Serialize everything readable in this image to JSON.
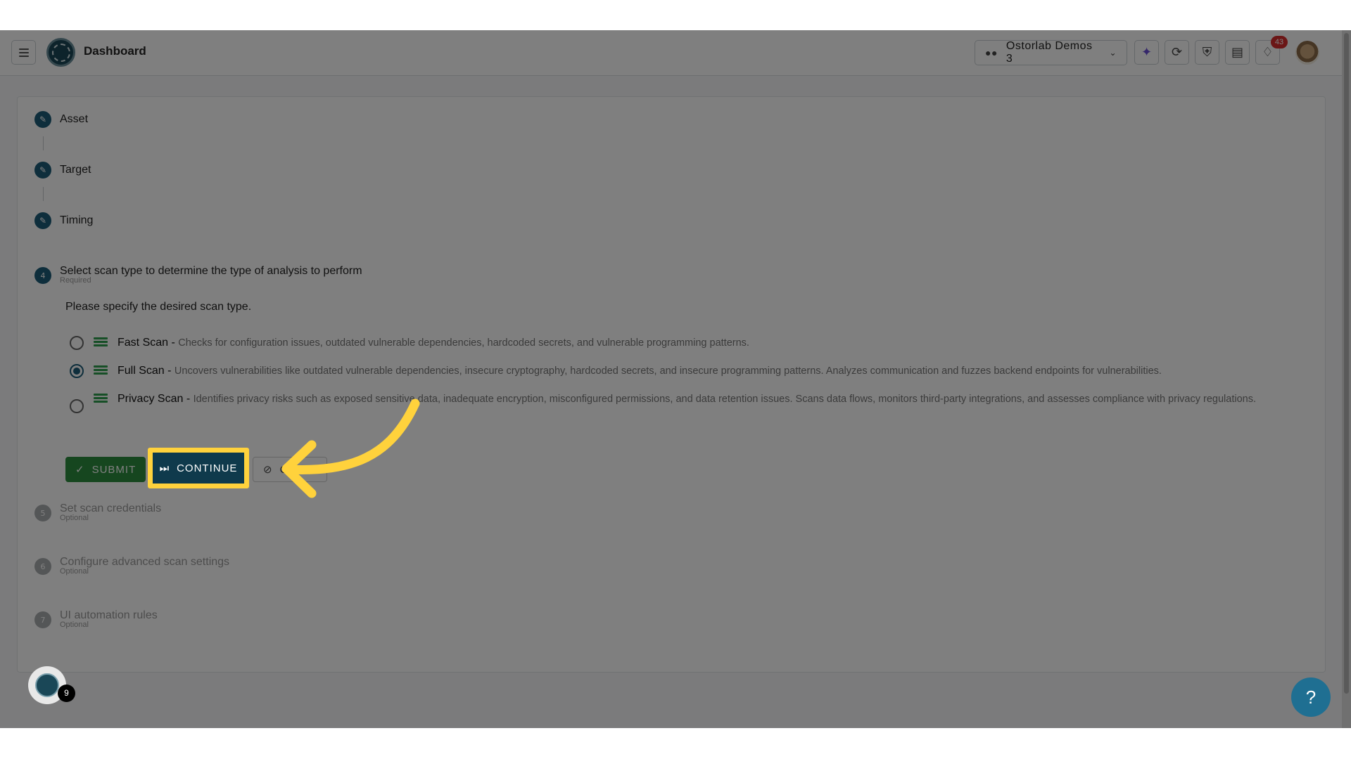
{
  "header": {
    "title": "Dashboard",
    "org_select": "Ostorlab Demos 3",
    "notification_count": "43"
  },
  "steps": [
    {
      "label": "Asset"
    },
    {
      "label": "Target"
    },
    {
      "label": "Timing"
    },
    {
      "number": "4",
      "label": "Select scan type to determine the type of analysis to perform",
      "sub": "Required"
    },
    {
      "number": "5",
      "label": "Set scan credentials",
      "sub": "Optional"
    },
    {
      "number": "6",
      "label": "Configure advanced scan settings",
      "sub": "Optional"
    },
    {
      "number": "7",
      "label": "UI automation rules",
      "sub": "Optional"
    }
  ],
  "scan": {
    "prompt": "Please specify the desired scan type.",
    "options": [
      {
        "name": "Fast Scan",
        "separator": " - ",
        "desc": "Checks for configuration issues, outdated vulnerable dependencies, hardcoded secrets, and vulnerable programming patterns.",
        "selected": false
      },
      {
        "name": "Full Scan",
        "separator": " - ",
        "desc": "Uncovers vulnerabilities like outdated vulnerable dependencies, insecure cryptography, hardcoded secrets, and insecure programming patterns. Analyzes communication and fuzzes backend endpoints for vulnerabilities.",
        "selected": true
      },
      {
        "name": "Privacy Scan",
        "separator": " - ",
        "desc": "Identifies privacy risks such as exposed sensitive data, inadequate encryption, misconfigured permissions, and data retention issues. Scans data flows, monitors third-party integrations, and assesses compliance with privacy regulations.",
        "selected": false
      }
    ]
  },
  "buttons": {
    "submit": "SUBMIT",
    "continue": "CONTINUE",
    "cancel": "CANCEL"
  },
  "floating": {
    "badge": "9"
  },
  "help": {
    "label": "?"
  },
  "colors": {
    "accent": "#1f6f92",
    "success": "#2d8c3f",
    "highlight": "#ffd23c",
    "alert": "#d62d2d"
  }
}
